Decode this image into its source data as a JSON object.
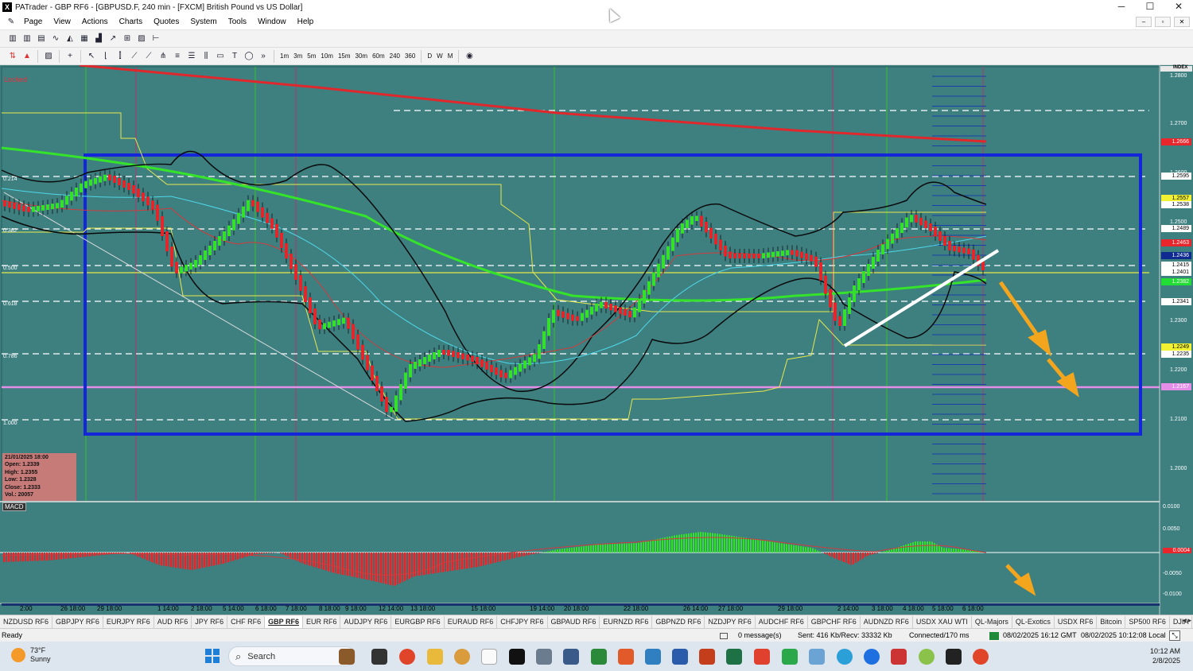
{
  "window": {
    "title": "PATrader - GBP RF6 - [GBPUSD.F, 240 min - [FXCM] British Pound vs US Dollar]",
    "controls": [
      "─",
      "☐",
      "✕"
    ]
  },
  "menu": [
    "Page",
    "View",
    "Actions",
    "Charts",
    "Quotes",
    "System",
    "Tools",
    "Window",
    "Help"
  ],
  "mdi_controls": [
    "–",
    "▫",
    "✕"
  ],
  "timeframes": [
    "1m",
    "3m",
    "5m",
    "10m",
    "15m",
    "30m",
    "60m",
    "240",
    "360",
    "D",
    "W",
    "M"
  ],
  "chart": {
    "locked_label": "Locked",
    "price_axis_title": "INDEX",
    "price_ticks": [
      "1.2800",
      "1.2700",
      "1.2600",
      "1.2500",
      "1.2400",
      "1.2300",
      "1.2200",
      "1.2100",
      "1.2000"
    ],
    "price_badges": [
      {
        "label": "1.2666",
        "bg": "#e8262c",
        "fg": "#ffffff"
      },
      {
        "label": "1.2595",
        "bg": "#ffffff",
        "fg": "#000000"
      },
      {
        "label": "1.2557",
        "bg": "#f2f233",
        "fg": "#000000"
      },
      {
        "label": "1.2538",
        "bg": "#ffffff",
        "fg": "#000000"
      },
      {
        "label": "1.2489",
        "bg": "#ffffff",
        "fg": "#000000"
      },
      {
        "label": "1.2463",
        "bg": "#e8262c",
        "fg": "#ffffff"
      },
      {
        "label": "1.2436",
        "bg": "#0f2b8f",
        "fg": "#ffffff"
      },
      {
        "label": "1.2415",
        "bg": "#ffffff",
        "fg": "#000000"
      },
      {
        "label": "1.2401",
        "bg": "#ffffff",
        "fg": "#000000"
      },
      {
        "label": "1.2382",
        "bg": "#22dd33",
        "fg": "#ffffff"
      },
      {
        "label": "1.2341",
        "bg": "#ffffff",
        "fg": "#000000"
      },
      {
        "label": "1.2249",
        "bg": "#f2f233",
        "fg": "#000000"
      },
      {
        "label": "1.2235",
        "bg": "#ffffff",
        "fg": "#000000"
      },
      {
        "label": "1.2167",
        "bg": "#e58ee8",
        "fg": "#ffffff"
      }
    ],
    "fib_labels": [
      "0.214",
      "0.382",
      "0.500",
      "0.618",
      "0.786",
      "1.000"
    ],
    "ohlc": {
      "date": "21/01/2025 18:00",
      "open": "Open: 1.2339",
      "high": "High: 1.2355",
      "low": "Low: 1.2328",
      "close": "Close: 1.2333",
      "vol": "Vol.: 20057"
    },
    "macd_label": "MACD",
    "macd_ticks": [
      "0.0100",
      "0.0050",
      "0.0004",
      "-0.0050",
      "-0.0100"
    ],
    "time_labels": [
      "2:00",
      "26 18:00",
      "29 18:00",
      "1 14:00",
      "2 18:00",
      "5 14:00",
      "6 18:00",
      "7 18:00",
      "8 18:00",
      "9 18:00",
      "12 14:00",
      "13 18:00",
      "15 18:00",
      "19 14:00",
      "20 18:00",
      "22 18:00",
      "26 14:00",
      "27 18:00",
      "29 18:00",
      "2 14:00",
      "3 18:00",
      "4 18:00",
      "5 18:00",
      "6 18:00"
    ]
  },
  "symbol_tabs": [
    "NZDUSD RF6",
    "GBPJPY RF6",
    "EURJPY RF6",
    "AUD RF6",
    "JPY RF6",
    "CHF RF6",
    "GBP RF6",
    "EUR RF6",
    "AUDJPY RF6",
    "EURGBP RF6",
    "EURAUD RF6",
    "CHFJPY RF6",
    "GBPAUD RF6",
    "EURNZD RF6",
    "GBPNZD RF6",
    "NZDJPY RF6",
    "AUDCHF RF6",
    "GBPCHF RF6",
    "AUDNZD RF6",
    "USDX XAU WTI",
    "QL-Majors",
    "QL-Exotics",
    "USDX RF6",
    "Bitcoin",
    "SP500 RF6",
    "DJIA"
  ],
  "active_tab": "GBP RF6",
  "status": {
    "ready": "Ready",
    "messages": "0 message(s)",
    "traffic": "Sent: 416 Kb/Recv: 33332 Kb",
    "connection": "Connected/170 ms",
    "gmt_time": "08/02/2025 16:12 GMT",
    "local_time": "08/02/2025 10:12:08 Local"
  },
  "taskbar": {
    "temperature": "73°F",
    "condition": "Sunny",
    "search_placeholder": "Search",
    "time": "10:12 AM",
    "date": "2/8/2025"
  }
}
